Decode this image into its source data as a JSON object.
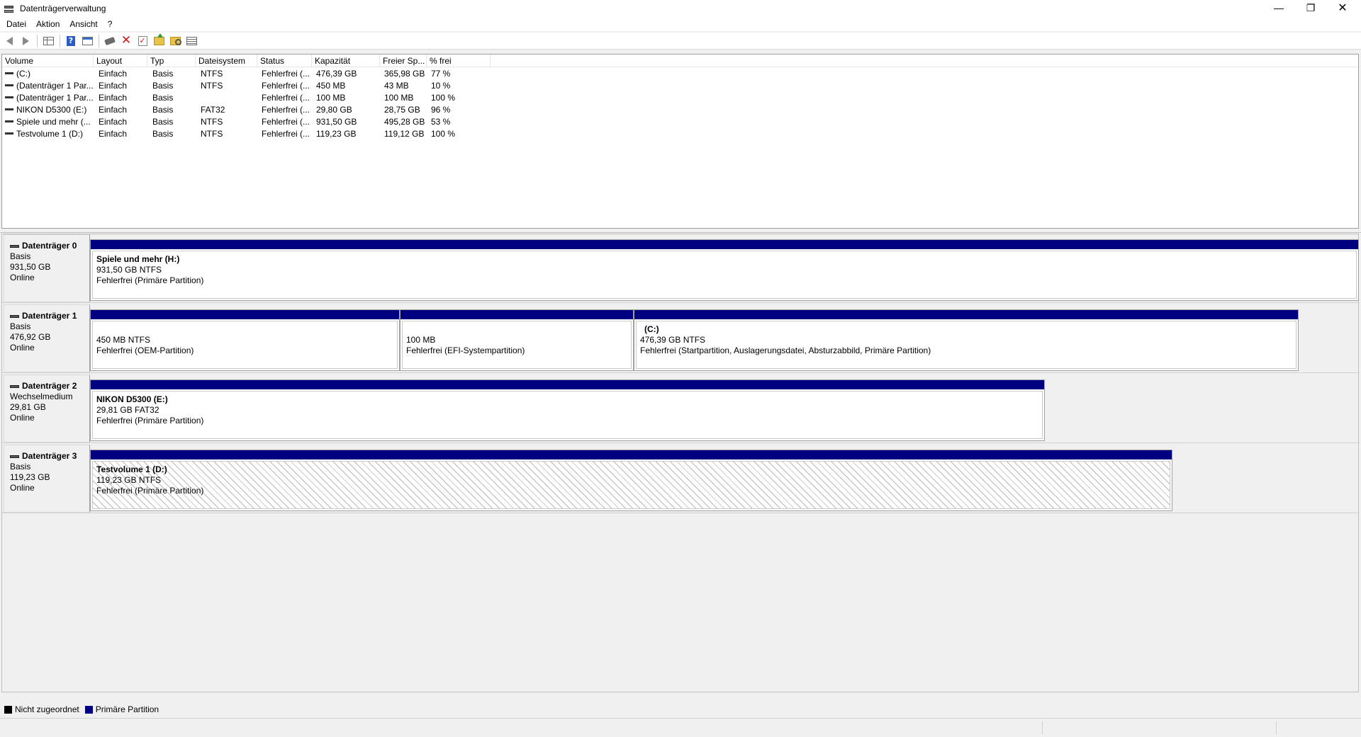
{
  "window": {
    "title": "Datenträgerverwaltung",
    "controls": {
      "minimize": "—",
      "restore": "❐",
      "close": "✕"
    }
  },
  "menu": [
    "Datei",
    "Aktion",
    "Ansicht",
    "?"
  ],
  "toolbar": {
    "icons": [
      "back-icon",
      "forward-icon",
      "console-tree-icon",
      "help-icon",
      "properties-icon",
      "connect-icon",
      "delete-icon",
      "check-icon",
      "folder-up-icon",
      "folder-search-icon",
      "list-view-icon"
    ],
    "delete_glyph": "✕",
    "check_glyph": "✓",
    "help_glyph": "?"
  },
  "volume_list": {
    "columns": [
      "Volume",
      "Layout",
      "Typ",
      "Dateisystem",
      "Status",
      "Kapazität",
      "Freier Sp...",
      "% frei"
    ],
    "rows": [
      [
        "(C:)",
        "Einfach",
        "Basis",
        "NTFS",
        "Fehlerfrei (...",
        "476,39 GB",
        "365,98 GB",
        "77 %"
      ],
      [
        "(Datenträger 1 Par...",
        "Einfach",
        "Basis",
        "NTFS",
        "Fehlerfrei (...",
        "450 MB",
        "43 MB",
        "10 %"
      ],
      [
        "(Datenträger 1 Par...",
        "Einfach",
        "Basis",
        "",
        "Fehlerfrei (...",
        "100 MB",
        "100 MB",
        "100 %"
      ],
      [
        "NIKON D5300 (E:)",
        "Einfach",
        "Basis",
        "FAT32",
        "Fehlerfrei (...",
        "29,80 GB",
        "28,75 GB",
        "96 %"
      ],
      [
        "Spiele und mehr (...",
        "Einfach",
        "Basis",
        "NTFS",
        "Fehlerfrei (...",
        "931,50 GB",
        "495,28 GB",
        "53 %"
      ],
      [
        "Testvolume 1 (D:)",
        "Einfach",
        "Basis",
        "NTFS",
        "Fehlerfrei (...",
        "119,23 GB",
        "119,12 GB",
        "100 %"
      ]
    ]
  },
  "disks": [
    {
      "name": "Datenträger 0",
      "type": "Basis",
      "size": "931,50 GB",
      "state": "Online",
      "partitions": [
        {
          "name": "Spiele und mehr  (H:)",
          "size": "931,50 GB NTFS",
          "status": "Fehlerfrei (Primäre Partition)"
        }
      ]
    },
    {
      "name": "Datenträger 1",
      "type": "Basis",
      "size": "476,92 GB",
      "state": "Online",
      "partitions": [
        {
          "name": "",
          "size": "450 MB NTFS",
          "status": "Fehlerfrei (OEM-Partition)"
        },
        {
          "name": "",
          "size": "100 MB",
          "status": "Fehlerfrei (EFI-Systempartition)"
        },
        {
          "name": "(C:)",
          "size": "476,39 GB NTFS",
          "status": "Fehlerfrei (Startpartition, Auslagerungsdatei, Absturzabbild, Primäre Partition)"
        }
      ]
    },
    {
      "name": "Datenträger 2",
      "type": "Wechselmedium",
      "size": "29,81 GB",
      "state": "Online",
      "partitions": [
        {
          "name": "NIKON D5300  (E:)",
          "size": "29,81 GB FAT32",
          "status": "Fehlerfrei (Primäre Partition)"
        }
      ]
    },
    {
      "name": "Datenträger 3",
      "type": "Basis",
      "size": "119,23 GB",
      "state": "Online",
      "partitions": [
        {
          "name": "Testvolume 1  (D:)",
          "size": "119,23 GB NTFS",
          "status": "Fehlerfrei (Primäre Partition)"
        }
      ]
    }
  ],
  "legend": [
    {
      "label": "Nicht zugeordnet",
      "color": "#000000"
    },
    {
      "label": "Primäre Partition",
      "color": "#000080"
    }
  ],
  "colors": {
    "partition_bar": "#000080",
    "unallocated": "#000000"
  }
}
